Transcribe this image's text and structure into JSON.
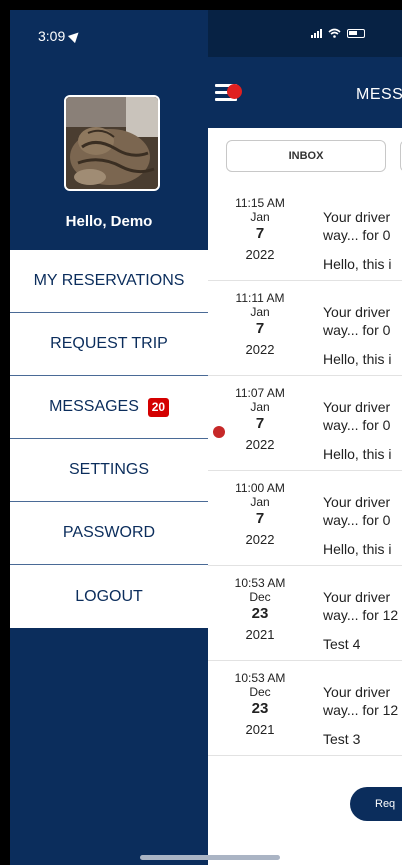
{
  "status_bar": {
    "time": "3:09"
  },
  "drawer": {
    "greeting": "Hello, Demo",
    "menu": [
      {
        "label": "MY RESERVATIONS"
      },
      {
        "label": "REQUEST TRIP"
      },
      {
        "label": "MESSAGES",
        "badge": "20"
      },
      {
        "label": "SETTINGS"
      },
      {
        "label": "PASSWORD"
      },
      {
        "label": "LOGOUT"
      }
    ]
  },
  "header": {
    "title": "MESS"
  },
  "tabs": {
    "inbox": "INBOX"
  },
  "messages": [
    {
      "time": "11:15 AM",
      "month": "Jan",
      "day": "7",
      "year": "2022",
      "line1": "Your driver",
      "line2": "way... for 0",
      "preview": "Hello, this i"
    },
    {
      "time": "11:11 AM",
      "month": "Jan",
      "day": "7",
      "year": "2022",
      "line1": "Your driver",
      "line2": "way... for 0",
      "preview": "Hello, this i"
    },
    {
      "time": "11:07 AM",
      "month": "Jan",
      "day": "7",
      "year": "2022",
      "line1": "Your driver",
      "line2": "way... for 0",
      "preview": "Hello, this i"
    },
    {
      "time": "11:00 AM",
      "month": "Jan",
      "day": "7",
      "year": "2022",
      "line1": "Your driver",
      "line2": "way... for 0",
      "preview": "Hello, this i"
    },
    {
      "time": "10:53 AM",
      "month": "Dec",
      "day": "23",
      "year": "2021",
      "line1": "Your driver",
      "line2": "way... for 12",
      "preview": "Test 4"
    },
    {
      "time": "10:53 AM",
      "month": "Dec",
      "day": "23",
      "year": "2021",
      "line1": "Your driver",
      "line2": "way... for 12",
      "preview": "Test 3"
    }
  ],
  "footer": {
    "request_button": "Req"
  },
  "colors": {
    "navy": "#0b2d5c",
    "badge_red": "#d40000",
    "notification_dot": "#e02020"
  },
  "icons": [
    "location-arrow-icon",
    "signal-icon",
    "wifi-icon",
    "battery-icon",
    "hamburger-menu-icon"
  ]
}
